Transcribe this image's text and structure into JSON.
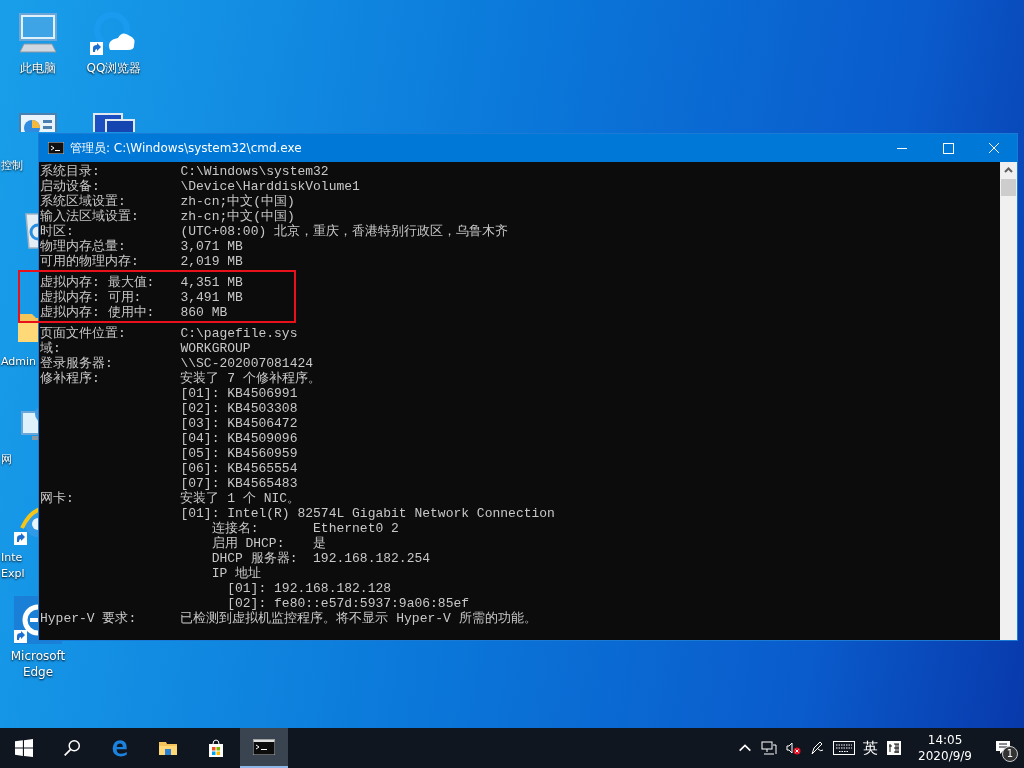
{
  "desktop": {
    "icons": [
      {
        "kind": "computer",
        "label": "此电脑",
        "shortcut": false,
        "partly_hidden": false
      },
      {
        "kind": "control-panel",
        "label": "控制",
        "shortcut": false,
        "partly_hidden": true
      },
      {
        "kind": "recycle-bin",
        "shortcut": false,
        "partly_hidden": true
      },
      {
        "kind": "folder",
        "label": "Admin",
        "shortcut": false,
        "partly_hidden": true
      },
      {
        "kind": "network",
        "label": "网",
        "shortcut": false,
        "partly_hidden": true
      },
      {
        "kind": "ie",
        "label": "Inte Expl",
        "shortcut": true,
        "partly_hidden": true
      },
      {
        "kind": "edge",
        "label": "Microsoft Edge",
        "shortcut": true,
        "partly_hidden": false
      },
      {
        "kind": "qq-browser",
        "label": "QQ浏览器",
        "shortcut": true,
        "partly_hidden": false
      },
      {
        "kind": "monitor",
        "partly_hidden": true
      }
    ]
  },
  "window": {
    "title": "管理员: C:\\Windows\\system32\\cmd.exe",
    "lines": [
      {
        "label": "系统目录:",
        "value": "C:\\Windows\\system32",
        "highlighted": false
      },
      {
        "label": "启动设备:",
        "value": "\\Device\\HarddiskVolume1",
        "highlighted": false
      },
      {
        "label": "系统区域设置:",
        "value": "zh-cn;中文(中国)",
        "highlighted": false
      },
      {
        "label": "输入法区域设置:",
        "value": "zh-cn;中文(中国)",
        "highlighted": false
      },
      {
        "label": "时区:",
        "value": "(UTC+08:00) 北京，重庆，香港特别行政区，乌鲁木齐",
        "highlighted": false
      },
      {
        "label": "物理内存总量:",
        "value": "3,071 MB",
        "highlighted": false
      },
      {
        "label": "可用的物理内存:",
        "value": "2,019 MB",
        "highlighted": false
      },
      {
        "label": "虚拟内存: 最大值:",
        "value": "4,351 MB",
        "highlighted": true
      },
      {
        "label": "虚拟内存: 可用:",
        "value": "3,491 MB",
        "highlighted": true
      },
      {
        "label": "虚拟内存: 使用中:",
        "value": "860 MB",
        "highlighted": true
      },
      {
        "label": "页面文件位置:",
        "value": "C:\\pagefile.sys",
        "highlighted": false
      },
      {
        "label": "域:",
        "value": "WORKGROUP",
        "highlighted": false
      },
      {
        "label": "登录服务器:",
        "value": "\\\\SC-202007081424",
        "highlighted": false
      },
      {
        "label": "修补程序:",
        "value": "安装了 7 个修补程序。",
        "highlighted": false,
        "children": [
          {
            "value": "[01]: KB4506991"
          },
          {
            "value": "[02]: KB4503308"
          },
          {
            "value": "[03]: KB4506472"
          },
          {
            "value": "[04]: KB4509096"
          },
          {
            "value": "[05]: KB4560959"
          },
          {
            "value": "[06]: KB4565554"
          },
          {
            "value": "[07]: KB4565483"
          }
        ]
      },
      {
        "label": "网卡:",
        "value": "安装了 1 个 NIC。",
        "highlighted": false,
        "children": [
          {
            "value": "[01]: Intel(R) 82574L Gigabit Network Connection",
            "children": [
              {
                "label": "连接名:",
                "value": "Ethernet0 2"
              },
              {
                "label": "启用 DHCP:",
                "value": "是"
              },
              {
                "label": "DHCP 服务器:",
                "value": "192.168.182.254"
              },
              {
                "label": "IP 地址",
                "children": [
                  {
                    "value": "[01]: 192.168.182.128"
                  },
                  {
                    "value": "[02]: fe80::e57d:5937:9a06:85ef"
                  }
                ]
              }
            ]
          }
        ]
      },
      {
        "label": "Hyper-V 要求:",
        "value": "已检测到虚拟机监控程序。将不显示 Hyper-V 所需的功能。",
        "highlighted": false
      }
    ]
  },
  "taskbar": {
    "apps": [
      {
        "kind": "start",
        "active": false
      },
      {
        "kind": "search",
        "active": false
      },
      {
        "kind": "edge",
        "active": false
      },
      {
        "kind": "explorer",
        "active": false
      },
      {
        "kind": "store",
        "active": false
      },
      {
        "kind": "cmd",
        "active": true
      }
    ],
    "tray": {
      "language": "英",
      "time": "14:05",
      "date": "2020/9/9",
      "notifications": "1"
    }
  }
}
